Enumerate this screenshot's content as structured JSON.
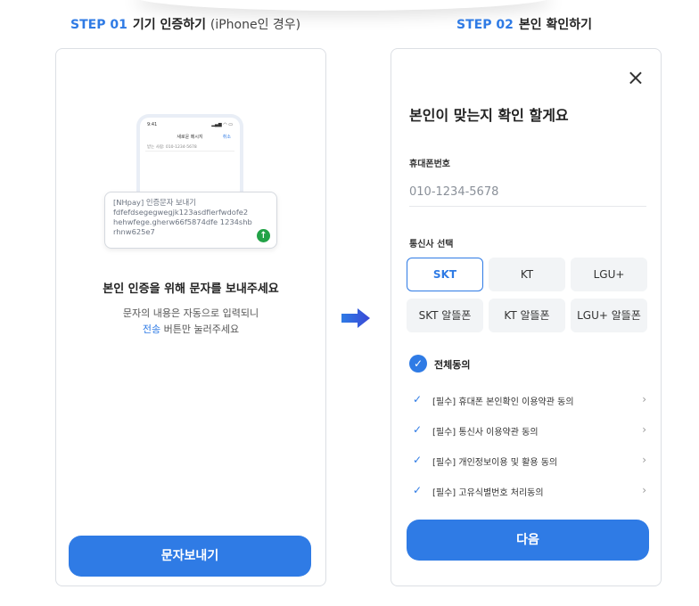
{
  "step1": {
    "step_number": "STEP 01",
    "title": "기기 인증하기",
    "subtitle": "(iPhone인 경우)",
    "phone_mock": {
      "status_time": "9:41",
      "status_icons": "▂▄▆ ◠ ▭",
      "title": "새로운 메시지",
      "cancel": "취소",
      "to_line": "받는 사람: 010-1234-5678"
    },
    "message_bubble": {
      "line1": "[NHpay] 인증문자 보내기",
      "line2": "fdfefdsegegwegjk123asdfierfwdofe2",
      "line3": "hehwfege.gherw66f5874dfe 1234shb",
      "line4": "rhnw625e7",
      "send_icon": "↑"
    },
    "heading": "본인 인증을 위해 문자를 보내주세요",
    "desc_line1": "문자의 내용은 자동으로 입력되니",
    "desc_highlight": "전송",
    "desc_line2_rest": " 버튼만 눌러주세요",
    "button_label": "문자보내기"
  },
  "step2": {
    "step_number": "STEP 02",
    "title": "본인 확인하기",
    "close_icon": "×",
    "heading": "본인이 맞는지 확인 할게요",
    "phone_label": "휴대폰번호",
    "phone_placeholder": "010-1234-5678",
    "carrier_label": "통신사 선택",
    "carriers": [
      "SKT",
      "KT",
      "LGU+",
      "SKT 알뜰폰",
      "KT 알뜰폰",
      "LGU+ 알뜰폰"
    ],
    "selected_carrier": "SKT",
    "agree_all": "전체동의",
    "agree_icon": "✓",
    "agreements": [
      "[필수] 휴대폰 본인확인 이용약관 동의",
      "[필수] 통신사 이용약관 동의",
      "[필수] 개인정보이용 및 활용 동의",
      "[필수] 고유식별번호 처리동의"
    ],
    "chevron": "›",
    "next_button": "다음"
  },
  "colors": {
    "accent": "#2f7be5",
    "send_green": "#22a247",
    "border": "#dcdfe4",
    "carrier_bg": "#f2f4f6"
  }
}
